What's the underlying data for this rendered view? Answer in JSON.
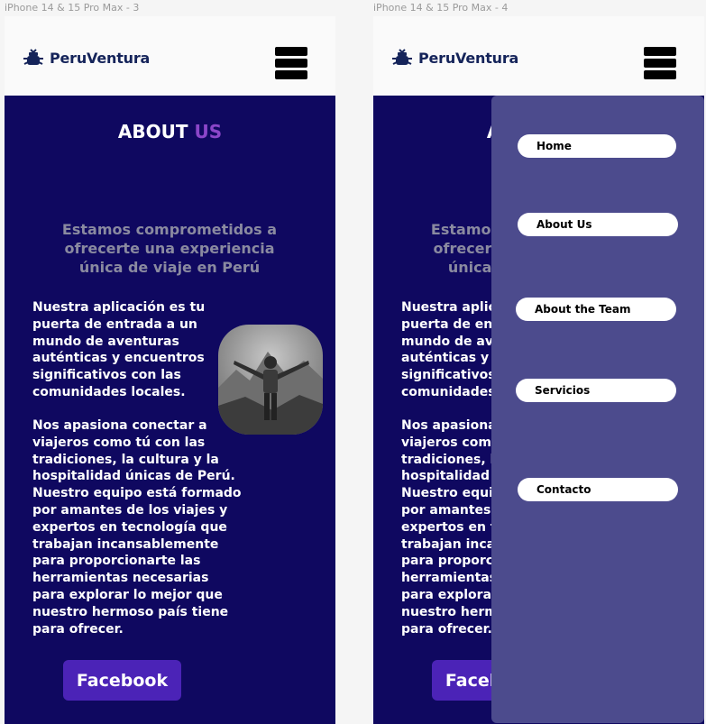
{
  "frames": [
    {
      "label": "iPhone 14 & 15 Pro Max - 3"
    },
    {
      "label": "iPhone 14 & 15 Pro Max - 4"
    }
  ],
  "header": {
    "logo_text": "PeruVentura",
    "logo_icon": "bug-icon",
    "menu_icon": "hamburger-icon"
  },
  "about": {
    "title_main": "ABOUT ",
    "title_accent": "US",
    "tagline": "Estamos comprometidos a ofrecerte una experiencia única de viaje en Perú",
    "paragraph1": "Nuestra aplicación es tu puerta de entrada a un mundo de aventuras auténticas y encuentros significativos con las comunidades locales.",
    "paragraph2": "Nos apasiona conectar a viajeros como tú con las tradiciones, la cultura y la hospitalidad únicas de Perú. Nuestro equipo está formado por amantes de los viajes y expertos en tecnología que trabajan incansablemente para proporcionarte las herramientas necesarias para explorar lo mejor que nuestro hermoso país tiene para ofrecer.",
    "facebook_label": "Facebook"
  },
  "menu": {
    "items": [
      {
        "label": "Home"
      },
      {
        "label": "About Us"
      },
      {
        "label": "About the Team"
      },
      {
        "label": "Servicios"
      },
      {
        "label": "Contacto"
      }
    ]
  },
  "colors": {
    "page_bg": "#f5f5f5",
    "content_bg": "#0f0860",
    "accent": "#8b46c9",
    "brand": "#15245a",
    "button": "#4b23b7",
    "menu_panel": "#4c4b8d"
  }
}
